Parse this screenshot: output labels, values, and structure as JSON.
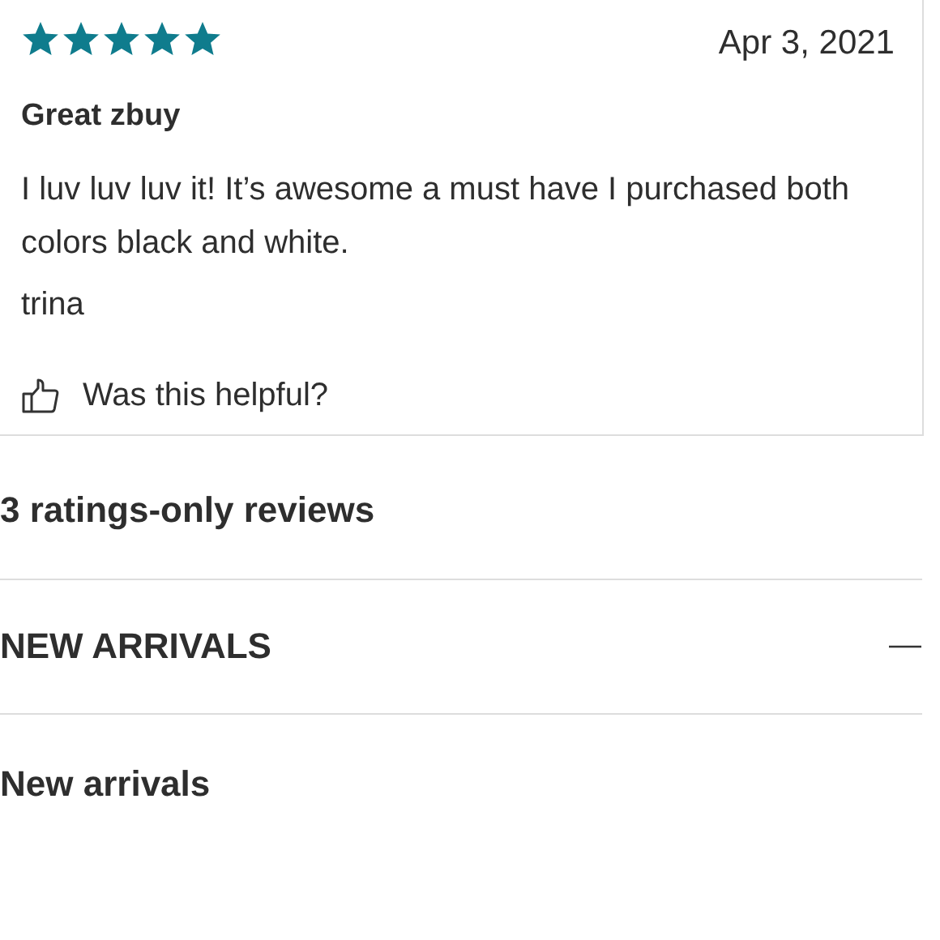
{
  "review": {
    "stars": 5,
    "date": "Apr 3, 2021",
    "title": "Great zbuy",
    "body": "I luv luv luv it! It’s awesome a must have I purchased both colors black and white.",
    "author": "trina",
    "helpful": "Was this helpful?"
  },
  "ratings_only": "3 ratings-only reviews",
  "sections": [
    {
      "heading": "NEW ARRIVALS",
      "expanded": true,
      "content": "New arrivals"
    }
  ]
}
